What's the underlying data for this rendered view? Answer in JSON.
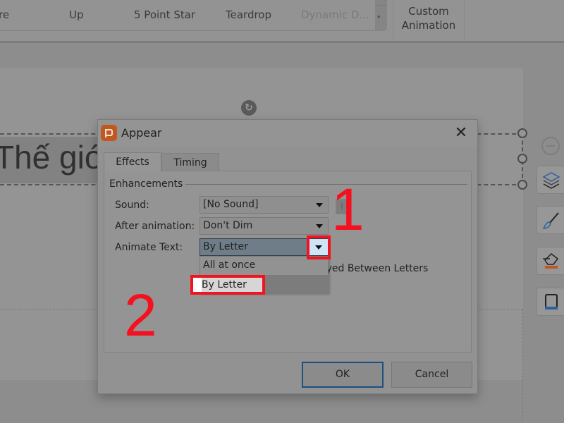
{
  "ribbon": {
    "gallery_items": [
      {
        "label": "re",
        "disabled": false
      },
      {
        "label": "Up",
        "disabled": false
      },
      {
        "label": "5 Point Star",
        "disabled": false
      },
      {
        "label": "Teardrop",
        "disabled": false
      },
      {
        "label": "Dynamic D...",
        "disabled": true
      }
    ],
    "custom_animation_label": "Custom\nAnimation"
  },
  "slide": {
    "title_text": "Thế giớ"
  },
  "dialog": {
    "title": "Appear",
    "tabs": [
      {
        "label": "Effects",
        "active": true
      },
      {
        "label": "Timing",
        "active": false
      }
    ],
    "group_label": "Enhancements",
    "fields": {
      "sound": {
        "label": "Sound:",
        "value": "[No Sound]"
      },
      "after_animation": {
        "label": "After animation:",
        "value": "Don't Dim"
      },
      "animate_text": {
        "label": "Animate Text:",
        "value": "By Letter"
      }
    },
    "animate_text_options": [
      "All at once",
      "By Letter"
    ],
    "delay_text": "ayed Between Letters",
    "ok_label": "OK",
    "cancel_label": "Cancel"
  },
  "annotations": {
    "step1": "1",
    "step2": "2",
    "highlighted_option": "By Letter",
    "color": "#f21321"
  }
}
